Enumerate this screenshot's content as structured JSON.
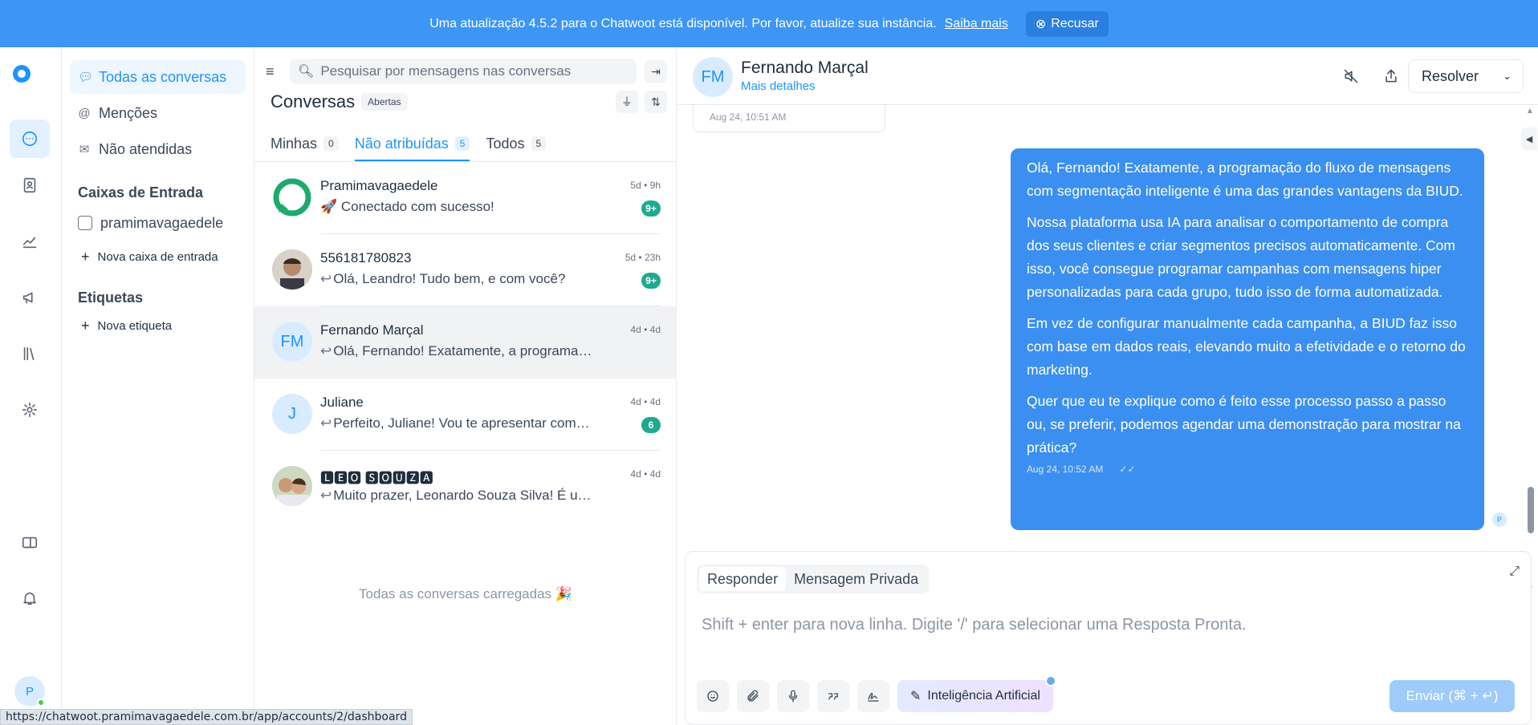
{
  "banner": {
    "text": "Uma atualização 4.5.2 para o Chatwoot está disponível. Por favor, atualize sua instância.",
    "link": "Saiba mais",
    "dismiss": "Recusar"
  },
  "user": {
    "initial": "P"
  },
  "sidebar": {
    "nav": [
      {
        "label": "Todas as conversas"
      },
      {
        "label": "Menções"
      },
      {
        "label": "Não atendidas"
      }
    ],
    "inboxes_title": "Caixas de Entrada",
    "inbox": "pramimavagaedele",
    "add_inbox": "Nova caixa de entrada",
    "labels_title": "Etiquetas",
    "add_label": "Nova etiqueta"
  },
  "list": {
    "search_placeholder": "Pesquisar por mensagens nas conversas",
    "title": "Conversas",
    "status": "Abertas",
    "tabs": [
      {
        "label": "Minhas",
        "count": "0"
      },
      {
        "label": "Não atribuídas",
        "count": "5"
      },
      {
        "label": "Todos",
        "count": "5"
      }
    ],
    "conversations": [
      {
        "name": "Pramimavagaedele",
        "message": "🚀 Conectado com sucesso!",
        "time": "5d • 9h",
        "badge": "9+",
        "avatar": ""
      },
      {
        "name": "556181780823",
        "message": "Olá, Leandro! Tudo bem, e com você?",
        "time": "5d • 23h",
        "badge": "9+",
        "avatar": ""
      },
      {
        "name": "Fernando Marçal",
        "message": "Olá, Fernando! Exatamente, a programação do fluxo",
        "time": "4d • 4d",
        "badge": "",
        "avatar": "FM"
      },
      {
        "name": "Juliane",
        "message": "Perfeito, Juliane! Vou te apresentar como funciona",
        "time": "4d • 4d",
        "badge": "6",
        "avatar": "J"
      },
      {
        "name": "🅻🅴🅾 🆂🅾🆄🆉🅰",
        "message": "Muito prazer, Leonardo Souza Silva! É um prazer",
        "time": "4d • 4d",
        "badge": "",
        "avatar": ""
      }
    ],
    "all_loaded": "Todas as conversas carregadas 🎉"
  },
  "chat": {
    "contact_name": "Fernando Marçal",
    "contact_initials": "FM",
    "more_details": "Mais detalhes",
    "resolve": "Resolver",
    "prev_time": "Aug 24, 10:51 AM",
    "message": [
      "Olá, Fernando! Exatamente, a programação do fluxo de mensagens com segmentação inteligente é uma das grandes vantagens da BIUD.",
      "Nossa plataforma usa IA para analisar o comportamento de compra dos seus clientes e criar segmentos precisos automaticamente. Com isso, você consegue programar campanhas com mensagens hiper personalizadas para cada grupo, tudo isso de forma automatizada.",
      "Em vez de configurar manualmente cada campanha, a BIUD faz isso com base em dados reais, elevando muito a efetividade e o retorno do marketing.",
      "Quer que eu te explique como é feito esse processo passo a passo ou, se preferir, podemos agendar uma demonstração para mostrar na prática?"
    ],
    "message_time": "Aug 24, 10:52 AM",
    "sender_initial": "P"
  },
  "composer": {
    "mode_reply": "Responder",
    "mode_private": "Mensagem Privada",
    "placeholder": "Shift + enter para nova linha. Digite '/' para selecionar uma Resposta Pronta.",
    "ai_label": "Inteligência Artificial",
    "send": "Enviar (⌘ + ↵)"
  },
  "statusbar": {
    "url": "https://chatwoot.pramimavagaedele.com.br/app/accounts/2/dashboard"
  },
  "colors": {
    "brand": "#1f93ff",
    "banner": "#3d96f5",
    "bubble": "#3b8ff0",
    "badge": "#1eaa8e"
  }
}
